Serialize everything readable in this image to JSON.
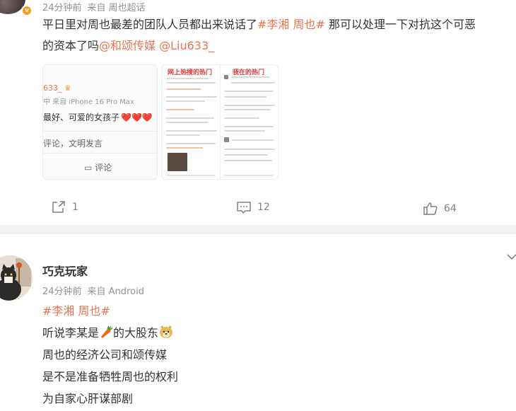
{
  "post1": {
    "meta_time": "24分钟前",
    "meta_source": "来自 周也超话",
    "text_line1_plain": "平日里对周也最差的团队人员都出来说话了",
    "text_line1_topic": "#李湘 周也#",
    "text_line1_tail": " 那可以处理一下对抗这个可恶",
    "text_line2_plain": "的资本了吗",
    "text_line2_mention1": "@和颂传媒",
    "text_line2_mention2": " @Liu633_",
    "thumb1": {
      "handle": "633_",
      "device": "中 来自 iPhone 16 Pro Max",
      "compliment": "最好、可爱的女孩子",
      "hearts": "❤️❤️❤️",
      "input_hint": "评论，文明发言",
      "comment_label": "评论"
    },
    "thumb2": {
      "left_title": "网上热搜的热门",
      "right_title": "我在的热门"
    },
    "actions": {
      "share_count": "1",
      "comment_count": "12",
      "like_count": "64"
    }
  },
  "post2": {
    "username": "巧克玩家",
    "meta_time": "24分钟前",
    "meta_source": "来自 Android",
    "topic": "#李湘 周也#",
    "line1_before": "听说李某是",
    "line1_after": "的大股东",
    "line2": "周也的经济公司和颂传媒",
    "line3": "是不是准备牺牲周也的权利",
    "line4": "为自家心肝谋部剧"
  }
}
